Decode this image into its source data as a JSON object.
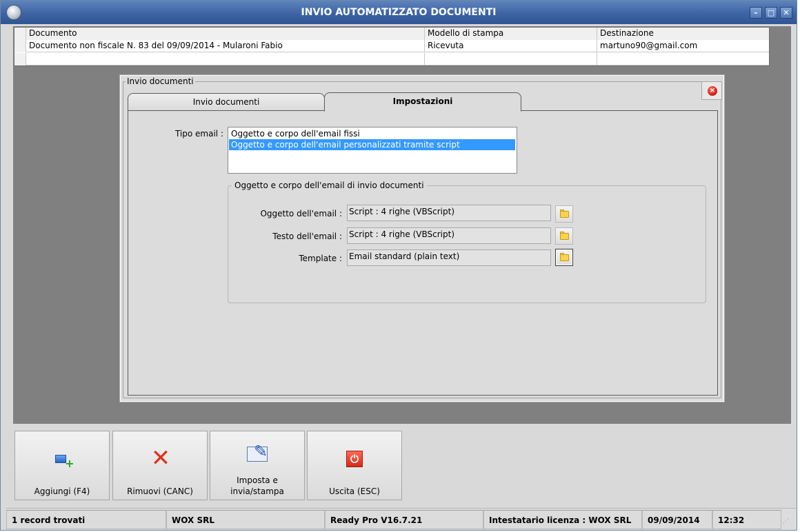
{
  "window": {
    "title": "INVIO AUTOMATIZZATO DOCUMENTI",
    "controls": {
      "minimize": "–",
      "maximize": "□",
      "close": "✕"
    }
  },
  "grid": {
    "columns": [
      "Documento",
      "Modello di stampa",
      "Destinazione"
    ],
    "rows": [
      [
        "Documento non fiscale N. 83 del 09/09/2014 - Mularoni Fabio",
        "Ricevuta",
        "martuno90@gmail.com"
      ],
      [
        "",
        "",
        ""
      ]
    ]
  },
  "dialog": {
    "group_title": "Invio documenti",
    "tabs": [
      {
        "label": "Invio documenti",
        "active": false
      },
      {
        "label": "Impostazioni",
        "active": true
      }
    ],
    "tipo_email_label": "Tipo email :",
    "tipo_email_options": [
      "Oggetto e corpo dell'email fissi",
      "Oggetto e corpo dell'email personalizzati tramite script"
    ],
    "tipo_email_selected": 1,
    "fieldset_title": "Oggetto e corpo dell'email di invio documenti",
    "fields": [
      {
        "label": "Oggetto dell'email :",
        "value": "Script : 4 righe (VBScript)"
      },
      {
        "label": "Testo dell'email :",
        "value": "Script : 4 righe (VBScript)"
      },
      {
        "label": "Template :",
        "value": "Email standard (plain text)"
      }
    ]
  },
  "buttons": [
    {
      "label": "Aggiungi (F4)",
      "icon": "add-document-icon"
    },
    {
      "label": "Rimuovi (CANC)",
      "icon": "red-x-icon"
    },
    {
      "label": "Imposta e invia/stampa",
      "icon": "envelope-pen-icon"
    },
    {
      "label": "Uscita (ESC)",
      "icon": "power-icon"
    }
  ],
  "status": {
    "records": "1 record trovati",
    "company": "WOX SRL",
    "version": "Ready Pro V16.7.21",
    "license": "Intestatario licenza : WOX SRL",
    "date": "09/09/2014",
    "time": "12:32"
  },
  "colors": {
    "titlebar": "#3d64a3",
    "selection": "#3399ff",
    "workspace": "#808080"
  }
}
